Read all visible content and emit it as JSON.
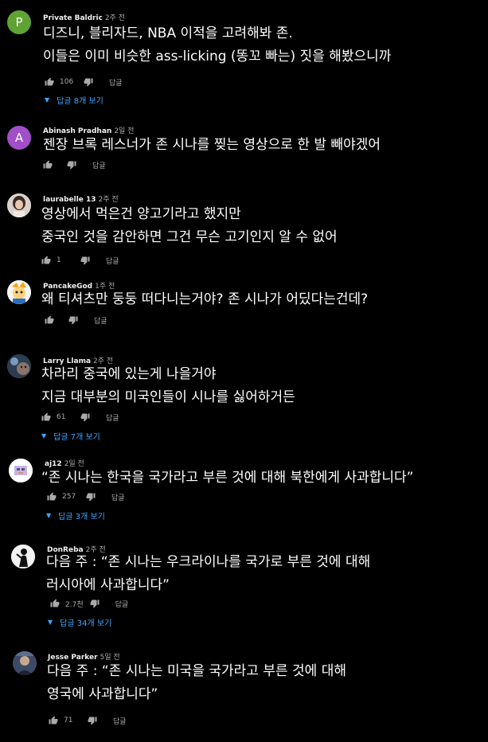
{
  "colors": {
    "background": "#000000",
    "link": "#3ea6ff",
    "meta": "#aaaaaa"
  },
  "comments": [
    {
      "author": "Private Baldric",
      "time": "2주 전",
      "avatar": {
        "type": "letter",
        "letter": "P",
        "color": "#5fa335"
      },
      "lines": [
        "디즈니, 블리자드, NBA 이적을 고려해봐 존.",
        "이들은 이미 비슷한 ass-licking (똥꼬 빠는) 짓을 해봤으니까"
      ],
      "likes": "106",
      "reply_label": "답글",
      "replies_label": "답글 8개 보기"
    },
    {
      "author": "Abinash Pradhan",
      "time": "2일 전",
      "avatar": {
        "type": "letter",
        "letter": "A",
        "color": "#a04fc9"
      },
      "lines": [
        "젠장 브록 레스너가 존 시나를 찢는 영상으로 한 발 빼야겠어"
      ],
      "likes": "",
      "reply_label": "답글",
      "replies_label": ""
    },
    {
      "author": "laurabelle 13",
      "time": "2주 전",
      "avatar": {
        "type": "photo",
        "name": "woman-photo-avatar"
      },
      "lines": [
        "영상에서 먹은건 양고기라고 했지만",
        "중국인 것을 감안하면 그건 무슨 고기인지 알 수 없어"
      ],
      "likes": "1",
      "reply_label": "답글",
      "replies_label": ""
    },
    {
      "author": "PancakeGod",
      "time": "1주 전",
      "avatar": {
        "type": "photo",
        "name": "anime-character-avatar"
      },
      "lines": [
        "왜 티셔츠만 둥둥 떠다니는거야? 존 시나가 어딨다는건데?"
      ],
      "likes": "",
      "reply_label": "답글",
      "replies_label": ""
    },
    {
      "author": "Larry Llama",
      "time": "2주 전",
      "avatar": {
        "type": "photo",
        "name": "llama-avatar"
      },
      "lines": [
        "차라리 중국에 있는게 나을거야",
        "지금 대부분의 미국인들이 시나를 싫어하거든"
      ],
      "likes": "61",
      "reply_label": "답글",
      "replies_label": "답글 7개 보기"
    },
    {
      "author": "aj12",
      "time": "2일 전",
      "avatar": {
        "type": "photo",
        "name": "pixel-art-avatar"
      },
      "lines": [
        "“존 시나는 한국을 국가라고 부른 것에 대해 북한에게 사과합니다”"
      ],
      "likes": "257",
      "reply_label": "답글",
      "replies_label": "답글 3개 보기"
    },
    {
      "author": "DonReba",
      "time": "2주 전",
      "avatar": {
        "type": "photo",
        "name": "silhouette-avatar"
      },
      "lines": [
        "다음 주 : “존 시나는 우크라이나를 국가로 부른 것에 대해",
        "러시아에 사과합니다”"
      ],
      "likes": "2.7천",
      "reply_label": "답글",
      "replies_label": "답글 34개 보기"
    },
    {
      "author": "Jesse Parker",
      "time": "5일 전",
      "avatar": {
        "type": "photo",
        "name": "person-photo-avatar"
      },
      "lines": [
        "다음 주 : “존 시나는 미국을 국가라고 부른 것에 대해",
        "영국에 사과합니다”"
      ],
      "likes": "71",
      "reply_label": "답글",
      "replies_label": ""
    }
  ]
}
